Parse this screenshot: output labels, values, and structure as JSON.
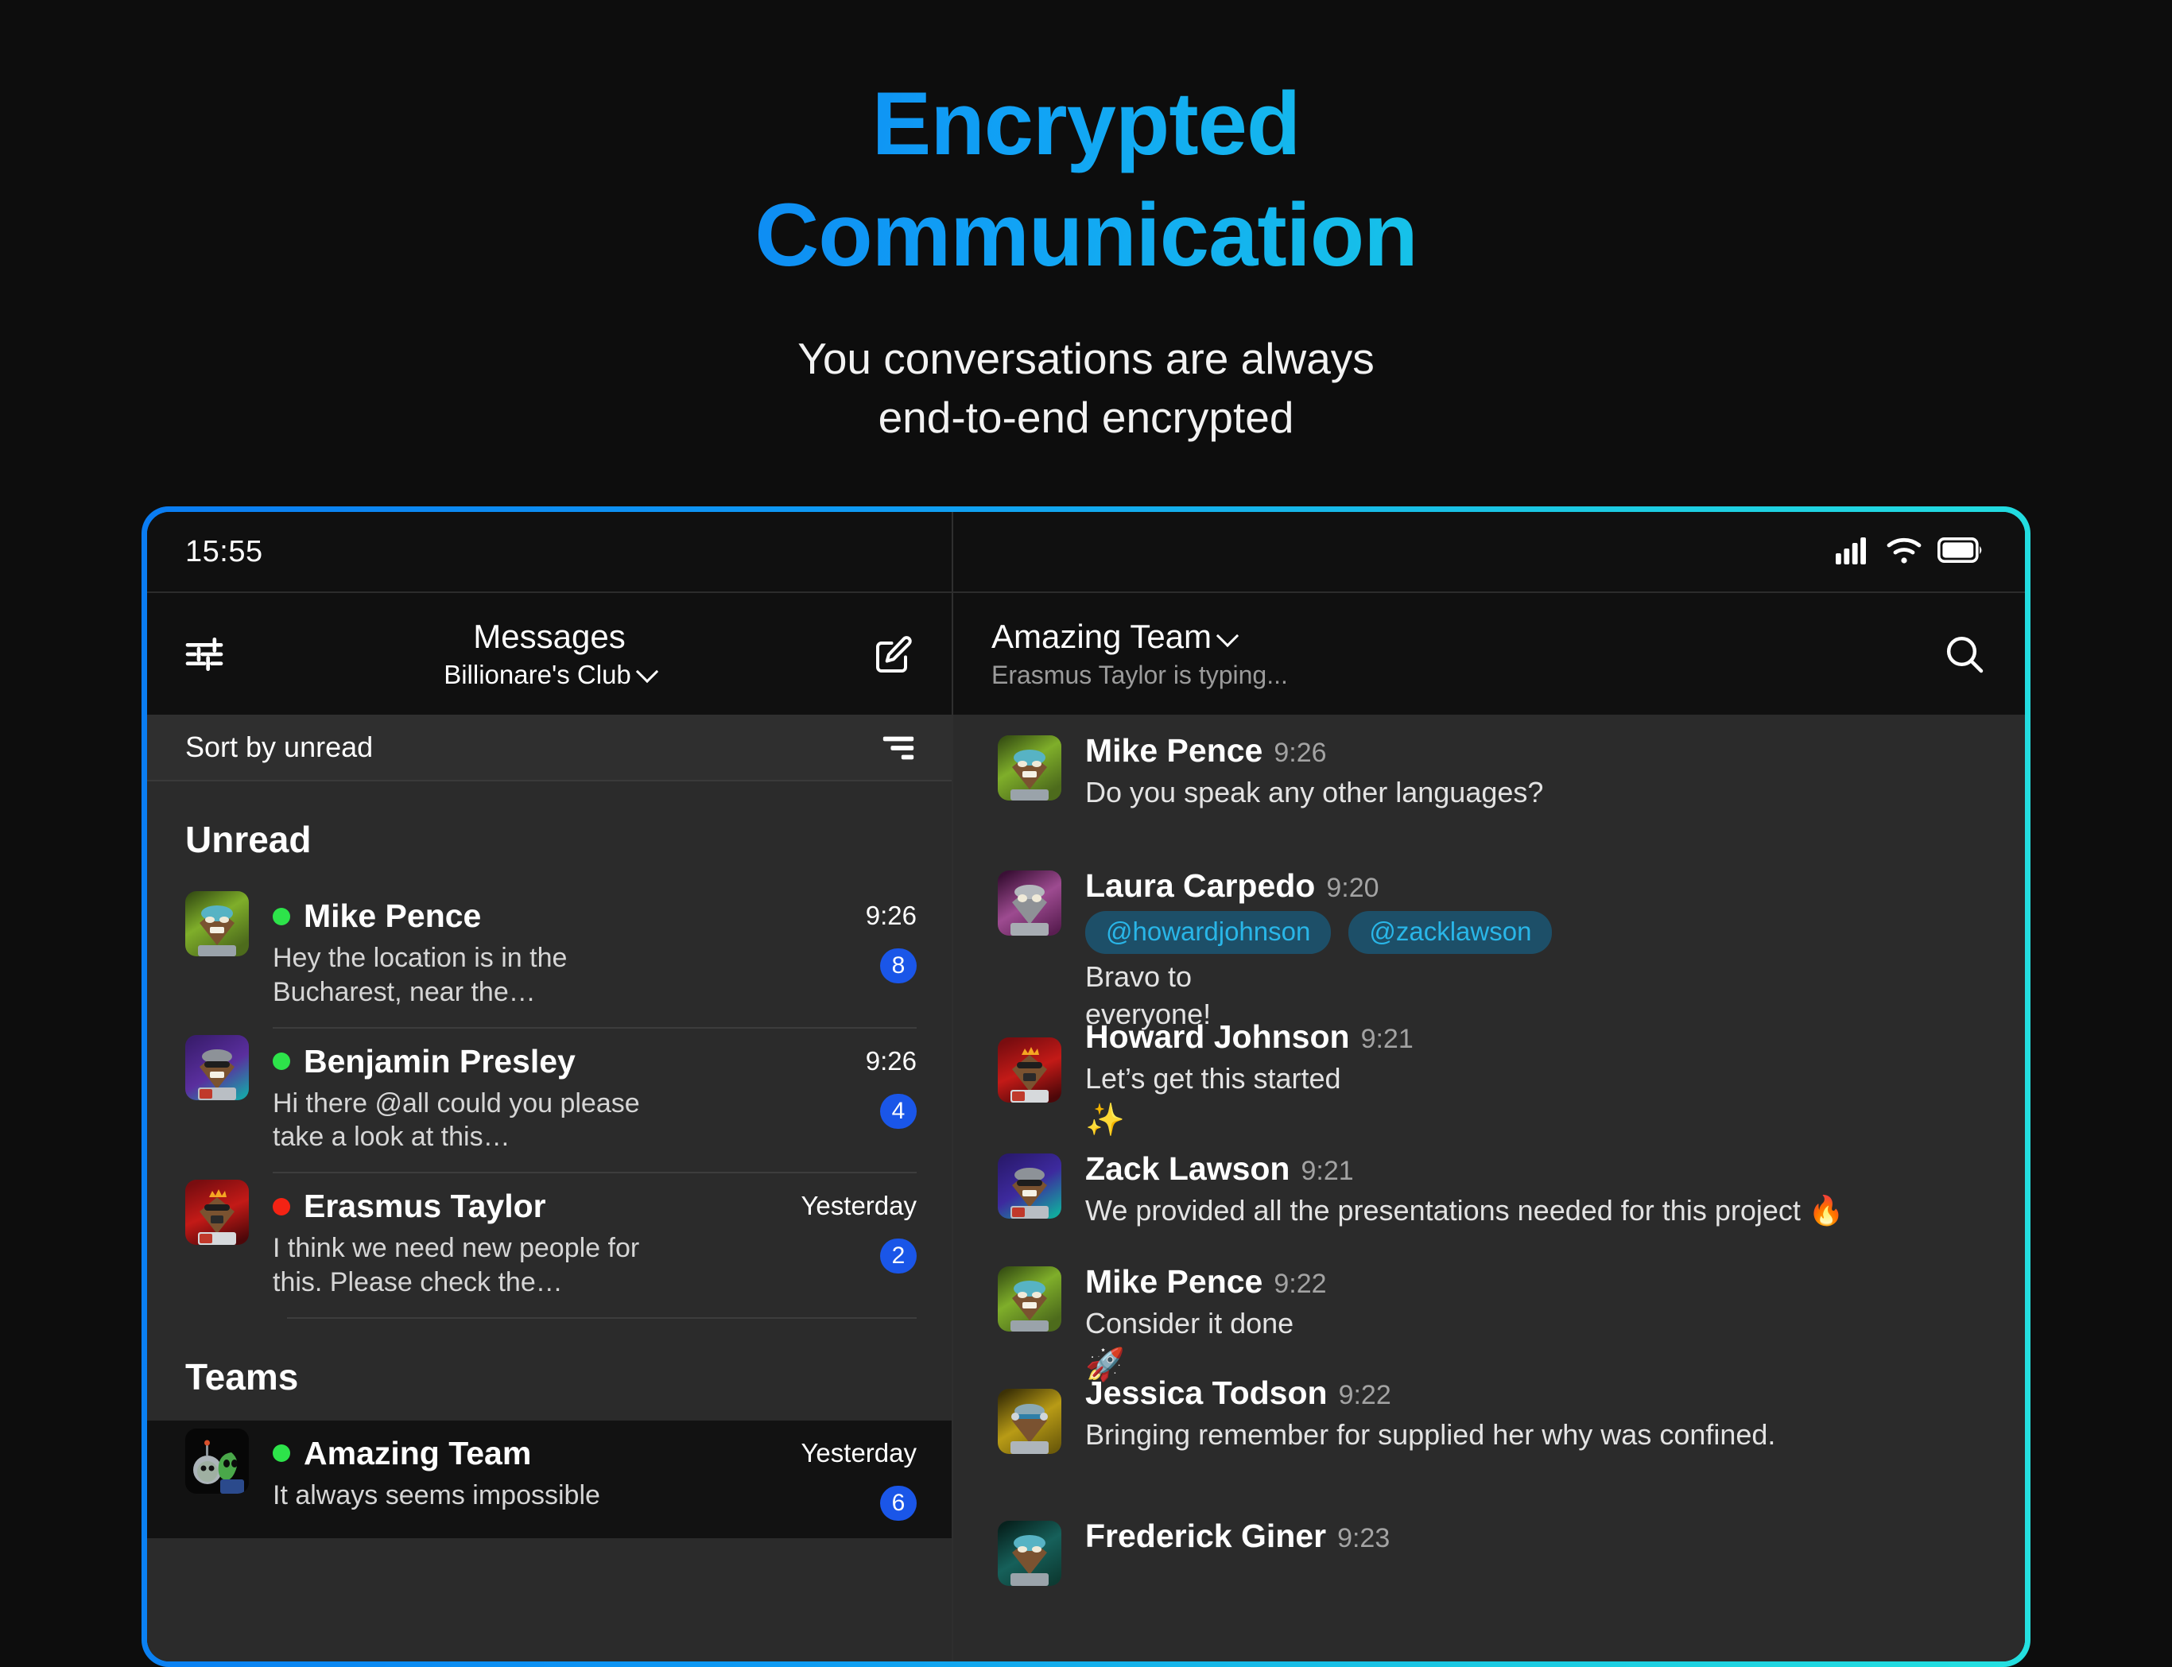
{
  "hero": {
    "title_line1": "Encrypted",
    "title_line2": "Communication",
    "subtitle_line1": "You conversations are always",
    "subtitle_line2": "end-to-end encrypted",
    "gradient_start": "#0a74f0",
    "gradient_end": "#1ad7e0"
  },
  "device": {
    "border_gradient_start": "#0a7cf2",
    "border_gradient_end": "#24e0e0"
  },
  "left": {
    "status": {
      "time": "15:55"
    },
    "header": {
      "settings_icon": "sliders-icon",
      "title": "Messages",
      "subtitle": "Billionare's Club",
      "subtitle_caret": "chevron-down-icon",
      "compose_icon": "compose-icon"
    },
    "sortbar": {
      "label": "Sort by unread",
      "filter_icon": "filter-icon"
    },
    "sections": [
      {
        "title": "Unread",
        "items": [
          {
            "name": "Mike Pence",
            "preview": "Hey the location is in the Bucharest, near the…",
            "time": "9:26",
            "badge": "8",
            "presence": "#2de34a",
            "avatar_colors": [
              "#4d6b1c",
              "#7fae2a",
              "#2d4310"
            ]
          },
          {
            "name": "Benjamin Presley",
            "preview": "Hi there @all could you please take a look at this…",
            "time": "9:26",
            "badge": "4",
            "presence": "#2de34a",
            "avatar_colors": [
              "#3a1d6e",
              "#5a2f9e",
              "#1aa0a8"
            ]
          },
          {
            "name": "Erasmus Taylor",
            "preview": "I think we need new people for this. Please check the…",
            "time": "Yesterday",
            "badge": "2",
            "presence": "#f42314",
            "avatar_colors": [
              "#7a0d10",
              "#c31a17",
              "#4d0709"
            ]
          }
        ]
      },
      {
        "title": "Teams",
        "items": [
          {
            "name": "Amazing Team",
            "preview": "It always seems impossible",
            "time": "Yesterday",
            "badge": "6",
            "presence": "#2de34a",
            "selected": true,
            "avatar_colors": [
              "#0a0a0a",
              "#1a1a1a",
              "#000000"
            ]
          }
        ]
      }
    ]
  },
  "right": {
    "status": {
      "signal_icon": "cellular-signal-icon",
      "wifi_icon": "wifi-icon",
      "battery_icon": "battery-icon"
    },
    "header": {
      "title": "Amazing Team",
      "title_caret": "chevron-down-icon",
      "subtitle": "Erasmus Taylor is typing...",
      "search_icon": "search-icon"
    },
    "messages": [
      {
        "name": "Mike Pence",
        "time": "9:26",
        "text": "Do you speak any other languages?",
        "avatar_colors": [
          "#4d6b1c",
          "#7fae2a",
          "#2d4310"
        ]
      },
      {
        "name": "Laura Carpedo",
        "time": "9:20",
        "mentions": [
          "@howardjohnson",
          "@zacklawson"
        ],
        "text": "Bravo to everyone!",
        "avatar_colors": [
          "#5a1e52",
          "#9d4b90",
          "#3b1036"
        ]
      },
      {
        "name": "Howard Johnson",
        "time": "9:21",
        "text": "Let’s get this started",
        "emoji": "✨",
        "avatar_colors": [
          "#7a0d10",
          "#c31a17",
          "#4d0709"
        ]
      },
      {
        "name": "Zack Lawson",
        "time": "9:21",
        "text": "We provided all the presentations needed for this project 🔥",
        "avatar_colors": [
          "#2a1a6e",
          "#3d2a9e",
          "#12a89e"
        ]
      },
      {
        "name": "Mike Pence",
        "time": "9:22",
        "text": "Consider it done",
        "emoji": "🚀",
        "avatar_colors": [
          "#4d6b1c",
          "#7fae2a",
          "#2d4310"
        ]
      },
      {
        "name": "Jessica Todson",
        "time": "9:22",
        "text": "Bringing remember for supplied her why was confined.",
        "avatar_colors": [
          "#6e5c0a",
          "#b89b16",
          "#3d3206"
        ]
      },
      {
        "name": "Frederick Giner",
        "time": "9:23",
        "text": "",
        "avatar_colors": [
          "#0d3b33",
          "#16605a",
          "#07221e"
        ]
      }
    ],
    "mention_pill_bg": "#1d4f68",
    "mention_pill_text": "#29b6e8"
  }
}
